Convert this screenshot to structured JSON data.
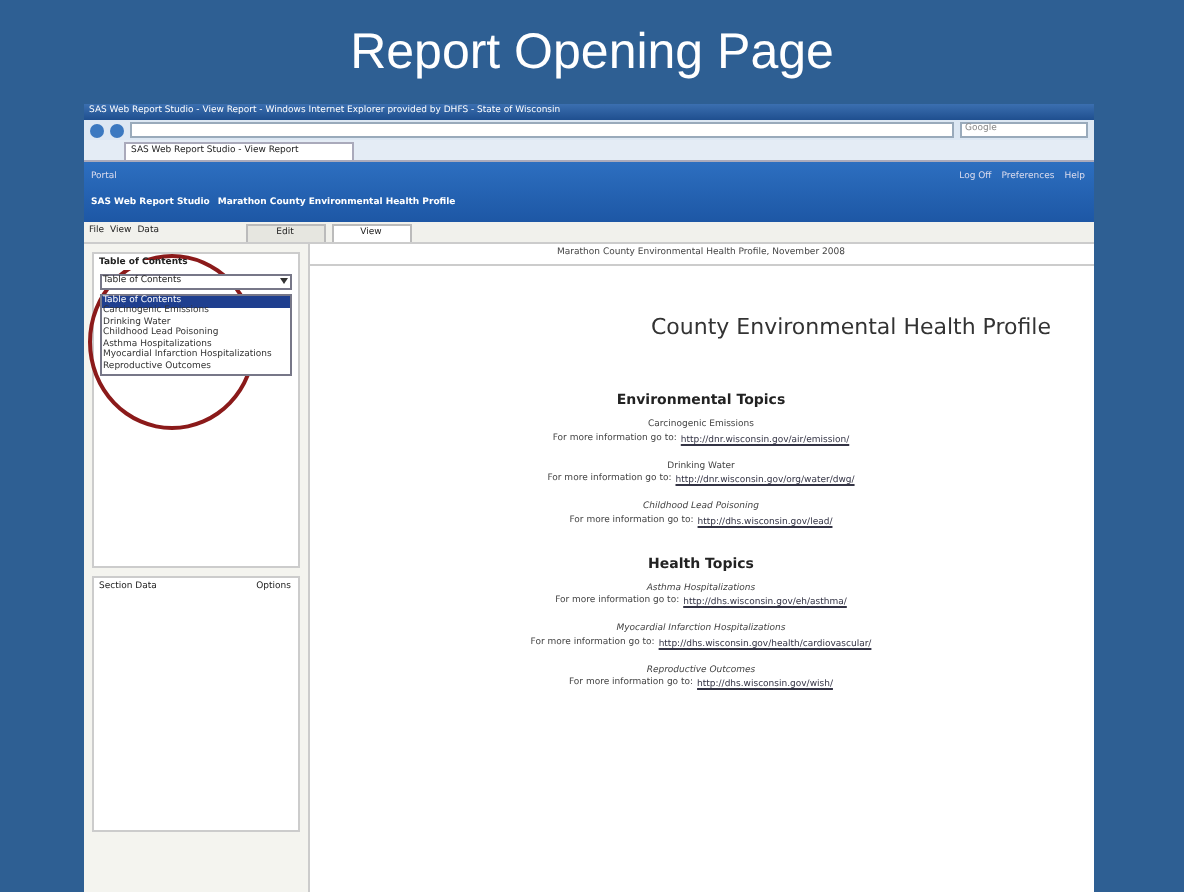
{
  "slide": {
    "title": "Report Opening Page"
  },
  "browser": {
    "title": "SAS Web Report Studio - View Report - Windows Internet Explorer provided by DHFS - State of Wisconsin",
    "tab": "SAS Web Report Studio - View Report",
    "search_placeholder": "Google"
  },
  "app_header": {
    "portal": "Portal",
    "breadcrumb": [
      "SAS Web Report Studio",
      "Marathon County Environmental Health Profile"
    ],
    "links": [
      "Log Off",
      "Preferences",
      "Help"
    ]
  },
  "menu": [
    "File",
    "View",
    "Data"
  ],
  "mode_tabs": [
    {
      "label": "Edit",
      "selected": false
    },
    {
      "label": "View",
      "selected": true
    }
  ],
  "toc": {
    "title": "Table of Contents",
    "dropdown": "Table of Contents",
    "items": [
      {
        "label": "Table of Contents",
        "selected": true
      },
      {
        "label": "Carcinogenic Emissions",
        "selected": false
      },
      {
        "label": "Drinking Water",
        "selected": false
      },
      {
        "label": "Childhood Lead Poisoning",
        "selected": false
      },
      {
        "label": "Asthma Hospitalizations",
        "selected": false
      },
      {
        "label": "Myocardial Infarction Hospitalizations",
        "selected": false
      },
      {
        "label": "Reproductive Outcomes",
        "selected": false
      }
    ]
  },
  "section_panel": {
    "title": "Section Data",
    "options": "Options"
  },
  "report": {
    "header": "Marathon County Environmental Health Profile, November 2008",
    "title": "County Environmental Health Profile",
    "sections": [
      {
        "heading": "Environmental Topics",
        "topics": [
          {
            "name": "Carcinogenic Emissions",
            "italic": false,
            "prompt": "For more information go to:",
            "link": "http://dnr.wisconsin.gov/air/emission/"
          },
          {
            "name": "Drinking Water",
            "italic": false,
            "prompt": "For more information go to:",
            "link": "http://dnr.wisconsin.gov/org/water/dwg/"
          },
          {
            "name": "Childhood Lead Poisoning",
            "italic": true,
            "prompt": "For more information go to:",
            "link": "http://dhs.wisconsin.gov/lead/"
          }
        ]
      },
      {
        "heading": "Health Topics",
        "topics": [
          {
            "name": "Asthma Hospitalizations",
            "italic": true,
            "prompt": "For more information go to:",
            "link": "http://dhs.wisconsin.gov/eh/asthma/"
          },
          {
            "name": "Myocardial Infarction Hospitalizations",
            "italic": true,
            "prompt": "For more information go to:",
            "link": "http://dhs.wisconsin.gov/health/cardiovascular/"
          },
          {
            "name": "Reproductive Outcomes",
            "italic": true,
            "prompt": "For more information go to:",
            "link": "http://dhs.wisconsin.gov/wish/"
          }
        ]
      }
    ]
  }
}
